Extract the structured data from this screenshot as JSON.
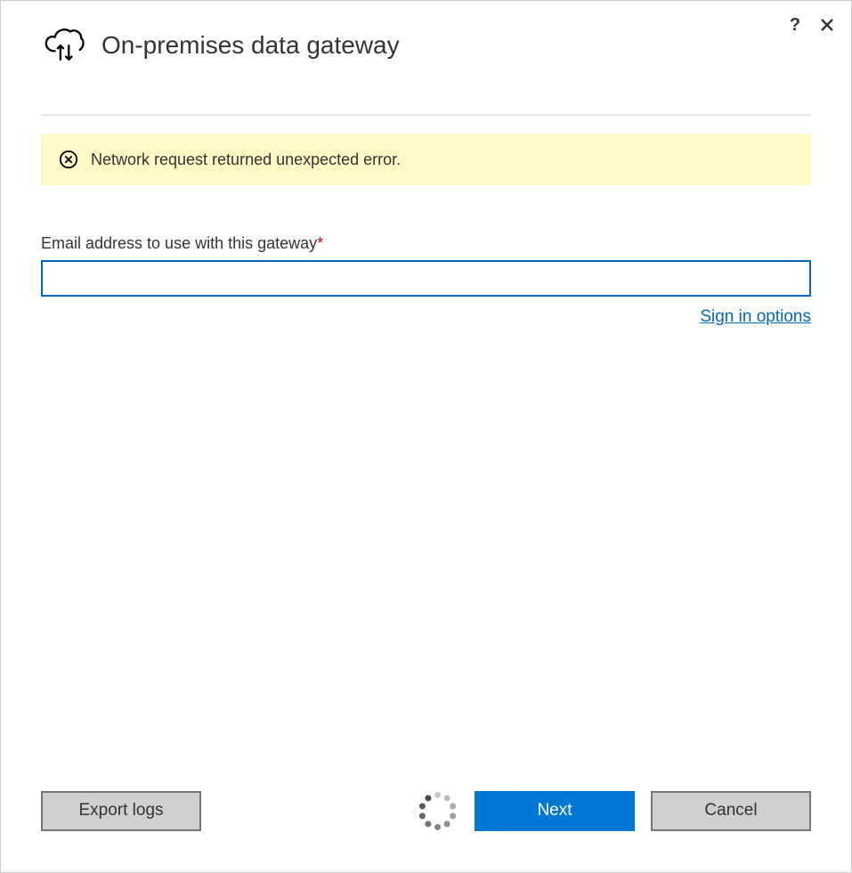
{
  "header": {
    "title": "On-premises data gateway"
  },
  "error": {
    "message": "Network request returned unexpected error."
  },
  "form": {
    "email_label": "Email address to use with this gateway",
    "email_value": "",
    "signin_options": "Sign in options"
  },
  "footer": {
    "export_logs": "Export logs",
    "next": "Next",
    "cancel": "Cancel"
  }
}
